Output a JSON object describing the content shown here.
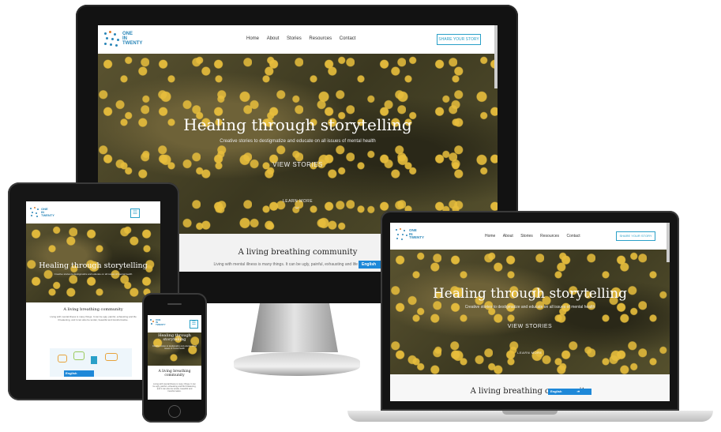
{
  "site": {
    "logo": {
      "line1": "ONE",
      "line2": "IN",
      "line3": "TWENTY"
    },
    "nav": [
      "Home",
      "About",
      "Stories",
      "Resources",
      "Contact"
    ],
    "share_button": "SHARE YOUR STORY",
    "hero": {
      "title": "Healing through storytelling",
      "subtitle": "Creative stories to destigmatize and educate on all issues of mental health",
      "cta": "VIEW STORIES",
      "learn_more": "LEARN MORE"
    },
    "community": {
      "title": "A living breathing community",
      "text_desktop": "Living with mental illness is many things. It can be ugly, painful, exhausting and life threatening...",
      "text_tablet": "Living with mental illness is many things. It can be ugly, painful, exhausting and life threatening, and it can also be tender, beautiful and transformative.",
      "text_phone": "Living with mental illness is many things. It can be ugly, painful, exhausting and life threatening, and it can also be tender, beautiful and transformative."
    },
    "language": "English",
    "menu_icon": "hamburger-icon"
  },
  "colors": {
    "accent": "#2aa0c8",
    "language_badge": "#1e88d8",
    "device_frame": "#1a1a1a",
    "hero_overlay": "#4a4528"
  }
}
